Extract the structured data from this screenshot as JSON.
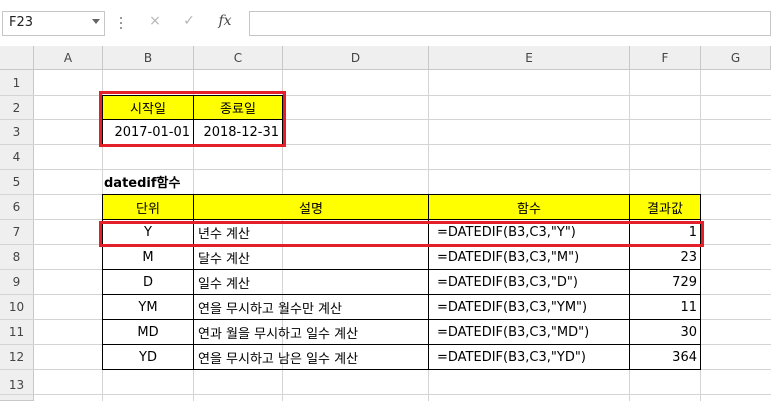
{
  "name_box": "F23",
  "formula_bar": {
    "cancel_icon": "×",
    "enter_icon": "✓",
    "fx_label": "fx",
    "formula": ""
  },
  "columns": [
    "A",
    "B",
    "C",
    "D",
    "E",
    "F",
    "G"
  ],
  "rows": [
    "1",
    "2",
    "3",
    "4",
    "5",
    "6",
    "7",
    "8",
    "9",
    "10",
    "11",
    "12",
    "13"
  ],
  "date_table": {
    "header_start": "시작일",
    "header_end": "종료일",
    "start_date": "2017-01-01",
    "end_date": "2018-12-31"
  },
  "section_title": "datedif함수",
  "datedif_table": {
    "headers": [
      "단위",
      "설명",
      "함수",
      "결과값"
    ],
    "rows": [
      [
        "Y",
        "년수 계산",
        "=DATEDIF(B3,C3,\"Y\")",
        "1"
      ],
      [
        "M",
        "달수 계산",
        "=DATEDIF(B3,C3,\"M\")",
        "23"
      ],
      [
        "D",
        "일수 계산",
        "=DATEDIF(B3,C3,\"D\")",
        "729"
      ],
      [
        "YM",
        "연을 무시하고 월수만 계산",
        "=DATEDIF(B3,C3,\"YM\")",
        "11"
      ],
      [
        "MD",
        "연과 월을 무시하고 일수 계산",
        "=DATEDIF(B3,C3,\"MD\")",
        "30"
      ],
      [
        "YD",
        "연을 무시하고 남은 일수 계산",
        "=DATEDIF(B3,C3,\"YD\")",
        "364"
      ]
    ]
  },
  "colors": {
    "highlight_yellow": "#ffff00",
    "annotation_red": "#e3202a",
    "header_gray": "#efefef"
  }
}
